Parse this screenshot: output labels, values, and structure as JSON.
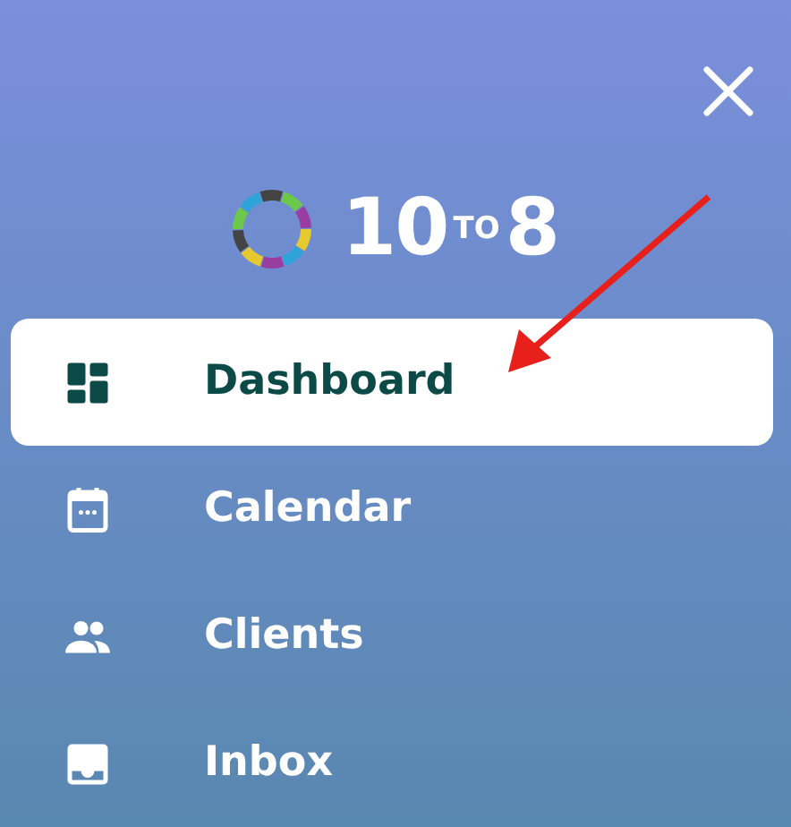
{
  "logo": {
    "number": "10",
    "joiner": "TO",
    "end": "8"
  },
  "menu": [
    {
      "label": "Dashboard",
      "kind": "dashboard",
      "selected": true
    },
    {
      "label": "Calendar",
      "kind": "calendar",
      "selected": false
    },
    {
      "label": "Clients",
      "kind": "clients",
      "selected": false
    },
    {
      "label": "Inbox",
      "kind": "inbox",
      "selected": false
    }
  ]
}
